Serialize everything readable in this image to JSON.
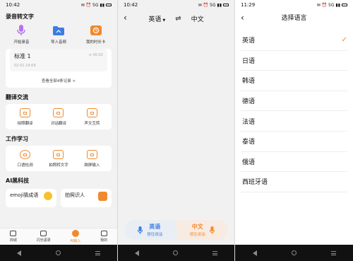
{
  "colors": {
    "accent": "#f08a2e",
    "mic_blue": "#3b7de0"
  },
  "panel1": {
    "status": {
      "time": "10:42",
      "icons": "✉ ⏰ 5G ▮▮"
    },
    "section1": {
      "title": "录音转文字",
      "tools": [
        {
          "label": "开始录音",
          "icon": "microphone-icon",
          "color": "#b673f0"
        },
        {
          "label": "导入音频",
          "icon": "folder-icon",
          "color": "#3b7de0"
        },
        {
          "label": "我的时长卡",
          "icon": "timer-card-icon",
          "color": "#f08a2e"
        }
      ],
      "record": {
        "title": "标准 1",
        "date": "02-01 14:09",
        "duration": "00:02"
      },
      "view_all": "查看全部4条记录 >"
    },
    "section2": {
      "title": "翻译交流",
      "tools": [
        {
          "label": "拍照翻译",
          "icon": "camera-translate-icon"
        },
        {
          "label": "对话翻译",
          "icon": "dialog-translate-icon"
        },
        {
          "label": "声文互转",
          "icon": "voice-text-icon"
        }
      ]
    },
    "section3": {
      "title": "工作学习",
      "tools": [
        {
          "label": "口语检测",
          "icon": "speech-check-icon"
        },
        {
          "label": "拍照转文字",
          "icon": "photo-text-icon"
        },
        {
          "label": "跨屏输入",
          "icon": "cross-screen-icon"
        }
      ]
    },
    "section4": {
      "title": "AI黑科技",
      "cards": [
        {
          "label": "emoji猜成语"
        },
        {
          "label": "拍照识人"
        }
      ]
    },
    "tabs": [
      {
        "label": "商城",
        "icon": "shop-icon",
        "active": false
      },
      {
        "label": "闪光语录",
        "icon": "quote-icon",
        "active": false
      },
      {
        "label": "AI输入",
        "icon": "ai-input-icon",
        "active": true
      },
      {
        "label": "我的",
        "icon": "profile-icon",
        "active": false
      }
    ]
  },
  "panel2": {
    "status": {
      "time": "10:42",
      "icons": "✉ ⏰ 5G ▮▮"
    },
    "source_lang": "英语",
    "target_lang": "中文",
    "swap_glyph": "⇌",
    "left_button": {
      "lang": "英语",
      "hint": "按住说话"
    },
    "right_button": {
      "lang": "中文",
      "hint": "按住说话"
    }
  },
  "panel3": {
    "status": {
      "time": "11:29",
      "icons": "✉ ⏰ 5G ▮▮"
    },
    "title": "选择语言",
    "languages": [
      {
        "label": "英语",
        "selected": true
      },
      {
        "label": "日语",
        "selected": false
      },
      {
        "label": "韩语",
        "selected": false
      },
      {
        "label": "德语",
        "selected": false
      },
      {
        "label": "法语",
        "selected": false
      },
      {
        "label": "泰语",
        "selected": false
      },
      {
        "label": "俄语",
        "selected": false
      },
      {
        "label": "西班牙语",
        "selected": false
      }
    ]
  }
}
